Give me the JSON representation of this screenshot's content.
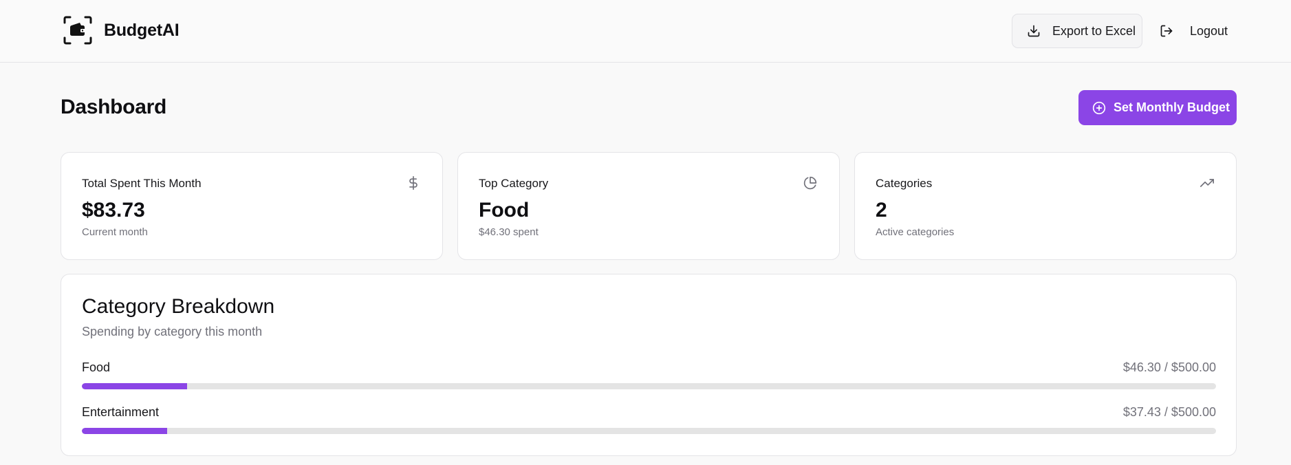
{
  "header": {
    "brand": "BudgetAI",
    "logo_icon": "wallet-icon",
    "export_label": "Export to Excel",
    "export_icon": "download-icon",
    "logout_label": "Logout",
    "logout_icon": "logout-icon"
  },
  "page": {
    "title": "Dashboard",
    "set_budget_label": "Set Monthly Budget",
    "set_budget_icon": "plus-circle-icon"
  },
  "stats": [
    {
      "title": "Total Spent This Month",
      "value": "$83.73",
      "sub": "Current month",
      "icon": "dollar-icon"
    },
    {
      "title": "Top Category",
      "value": "Food",
      "sub": "$46.30 spent",
      "icon": "pie-chart-icon"
    },
    {
      "title": "Categories",
      "value": "2",
      "sub": "Active categories",
      "icon": "trending-up-icon"
    }
  ],
  "breakdown": {
    "title": "Category Breakdown",
    "subtitle": "Spending by category this month",
    "items": [
      {
        "label": "Food",
        "amount": "$46.30 / $500.00",
        "progress": 0.0926
      },
      {
        "label": "Entertainment",
        "amount": "$37.43 / $500.00",
        "progress": 0.0749
      }
    ]
  },
  "colors": {
    "accent": "#8b45e6",
    "track": "#e4e4e4",
    "muted_text": "#71717a",
    "background": "#f9f9f9"
  }
}
